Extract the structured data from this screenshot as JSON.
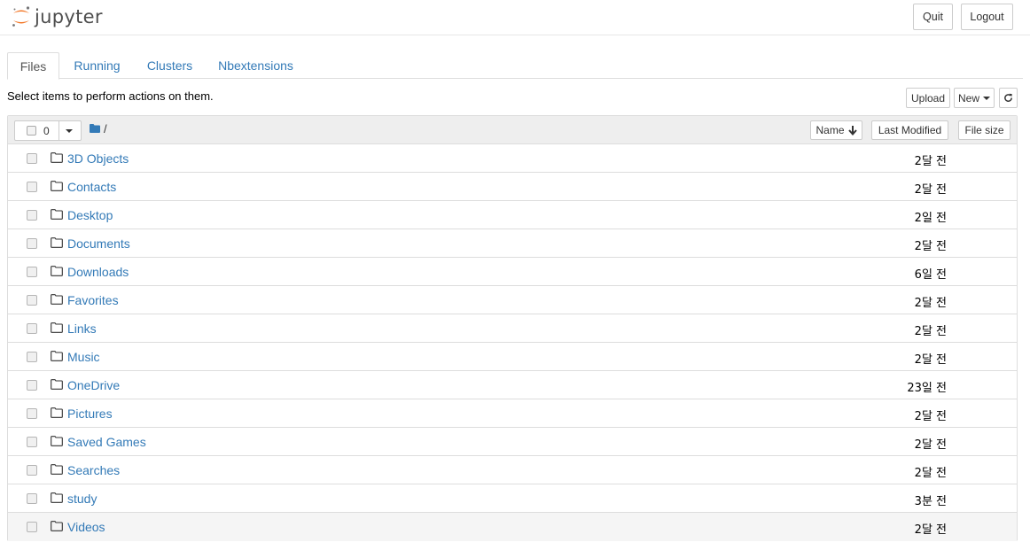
{
  "header": {
    "logo_text": "jupyter",
    "quit_label": "Quit",
    "logout_label": "Logout"
  },
  "tabs": [
    {
      "label": "Files",
      "active": true
    },
    {
      "label": "Running",
      "active": false
    },
    {
      "label": "Clusters",
      "active": false
    },
    {
      "label": "Nbextensions",
      "active": false
    }
  ],
  "toolbar": {
    "info_text": "Select items to perform actions on them.",
    "upload_label": "Upload",
    "new_label": "New"
  },
  "list_header": {
    "selected_count": "0",
    "path": "/",
    "sort_name_label": "Name",
    "sort_modified_label": "Last Modified",
    "sort_size_label": "File size"
  },
  "items": [
    {
      "name": "3D Objects",
      "modified": "2달 전"
    },
    {
      "name": "Contacts",
      "modified": "2달 전"
    },
    {
      "name": "Desktop",
      "modified": "2일 전"
    },
    {
      "name": "Documents",
      "modified": "2달 전"
    },
    {
      "name": "Downloads",
      "modified": "6일 전"
    },
    {
      "name": "Favorites",
      "modified": "2달 전"
    },
    {
      "name": "Links",
      "modified": "2달 전"
    },
    {
      "name": "Music",
      "modified": "2달 전"
    },
    {
      "name": "OneDrive",
      "modified": "23일 전"
    },
    {
      "name": "Pictures",
      "modified": "2달 전"
    },
    {
      "name": "Saved Games",
      "modified": "2달 전"
    },
    {
      "name": "Searches",
      "modified": "2달 전"
    },
    {
      "name": "study",
      "modified": "3분 전"
    },
    {
      "name": "Videos",
      "modified": "2달 전"
    }
  ],
  "colors": {
    "link": "#337ab7",
    "logo_orange": "#f37626",
    "logo_gray": "#767677"
  },
  "icons": {
    "logo": "jupyter-logo-icon",
    "folder": "folder-outline-icon",
    "path_folder": "folder-solid-icon",
    "sort": "arrow-down-icon",
    "refresh": "refresh-icon"
  }
}
